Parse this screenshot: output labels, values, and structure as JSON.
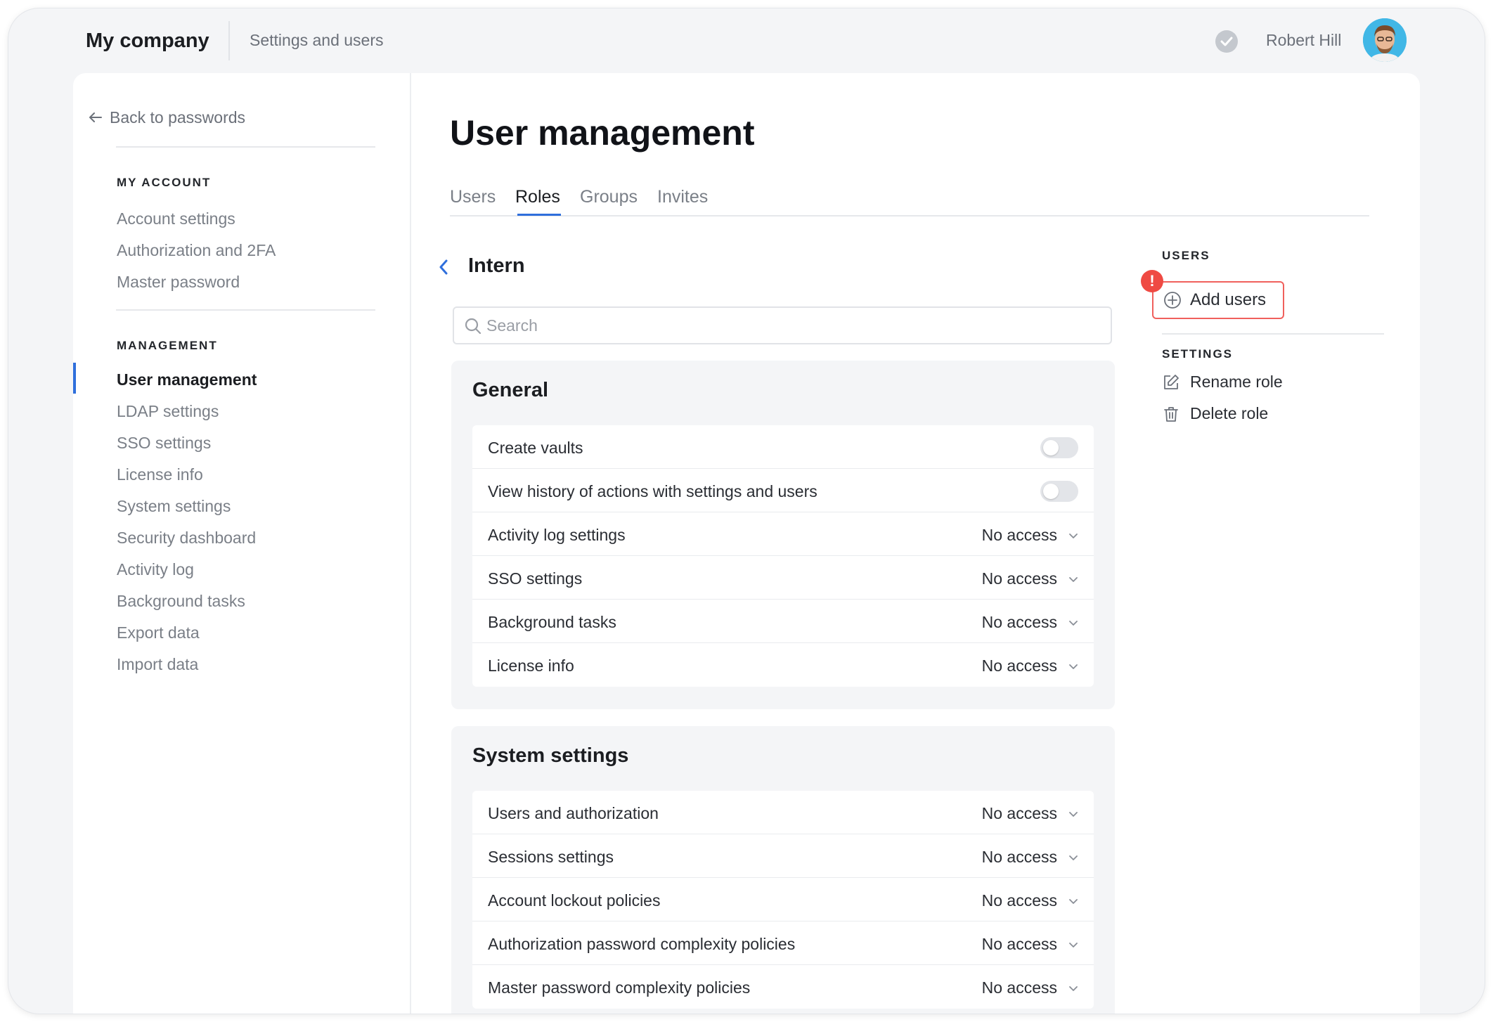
{
  "header": {
    "brand": "My company",
    "section": "Settings and users",
    "user_name": "Robert Hill"
  },
  "sidebar": {
    "back_label": "Back to passwords",
    "my_account": {
      "label": "MY ACCOUNT",
      "items": [
        "Account settings",
        "Authorization and 2FA",
        "Master password"
      ]
    },
    "management": {
      "label": "MANAGEMENT",
      "items": [
        "User management",
        "LDAP settings",
        "SSO settings",
        "License info",
        "System settings",
        "Security dashboard",
        "Activity log",
        "Background tasks",
        "Export data",
        "Import data"
      ]
    }
  },
  "main": {
    "title": "User management",
    "tabs": [
      "Users",
      "Roles",
      "Groups",
      "Invites"
    ],
    "active_tab": "Roles",
    "role_name": "Intern",
    "search_placeholder": "Search",
    "groups": [
      {
        "title": "General",
        "rows": [
          {
            "label": "Create vaults",
            "control": "toggle",
            "on": false
          },
          {
            "label": "View history of actions with settings and users",
            "control": "toggle",
            "on": false
          },
          {
            "label": "Activity log settings",
            "control": "select",
            "value": "No access"
          },
          {
            "label": "SSO settings",
            "control": "select",
            "value": "No access"
          },
          {
            "label": "Background tasks",
            "control": "select",
            "value": "No access"
          },
          {
            "label": "License info",
            "control": "select",
            "value": "No access"
          }
        ]
      },
      {
        "title": "System settings",
        "rows": [
          {
            "label": "Users and authorization",
            "control": "select",
            "value": "No access"
          },
          {
            "label": "Sessions settings",
            "control": "select",
            "value": "No access"
          },
          {
            "label": "Account lockout policies",
            "control": "select",
            "value": "No access"
          },
          {
            "label": "Authorization password complexity policies",
            "control": "select",
            "value": "No access"
          },
          {
            "label": "Master password complexity policies",
            "control": "select",
            "value": "No access"
          }
        ]
      }
    ]
  },
  "right_panel": {
    "users_label": "USERS",
    "add_users_label": "Add users",
    "alert_badge": "!",
    "settings_label": "SETTINGS",
    "rename_label": "Rename role",
    "delete_label": "Delete role"
  },
  "colors": {
    "accent": "#2f6fdc",
    "alert": "#ef4a43"
  }
}
